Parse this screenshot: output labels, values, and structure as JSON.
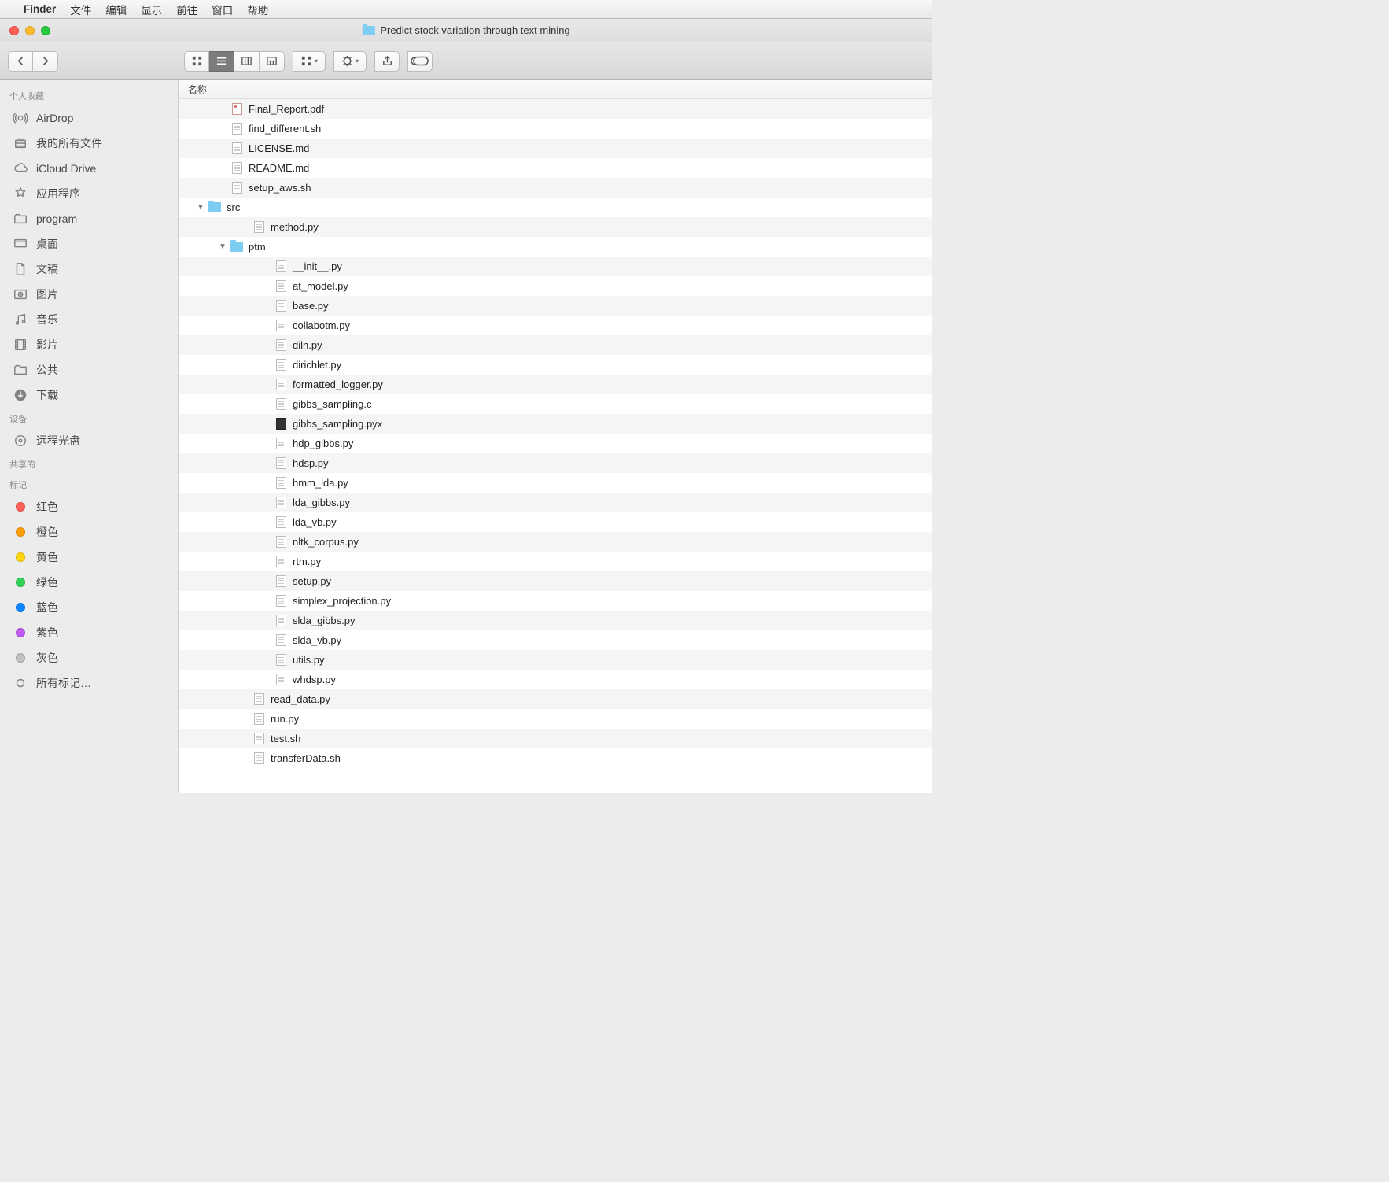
{
  "menubar": {
    "app": "Finder",
    "items": [
      "文件",
      "编辑",
      "显示",
      "前往",
      "窗口",
      "帮助"
    ]
  },
  "window": {
    "title": "Predict stock variation through text mining"
  },
  "list_header": "名称",
  "sidebar": {
    "sections": [
      {
        "label": "个人收藏",
        "items": [
          {
            "icon": "airdrop",
            "label": "AirDrop"
          },
          {
            "icon": "allfiles",
            "label": "我的所有文件"
          },
          {
            "icon": "icloud",
            "label": "iCloud Drive"
          },
          {
            "icon": "apps",
            "label": "应用程序"
          },
          {
            "icon": "folder",
            "label": "program"
          },
          {
            "icon": "desktop",
            "label": "桌面"
          },
          {
            "icon": "docs",
            "label": "文稿"
          },
          {
            "icon": "pictures",
            "label": "图片"
          },
          {
            "icon": "music",
            "label": "音乐"
          },
          {
            "icon": "movies",
            "label": "影片"
          },
          {
            "icon": "folder",
            "label": "公共"
          },
          {
            "icon": "downloads",
            "label": "下载"
          }
        ]
      },
      {
        "label": "设备",
        "items": [
          {
            "icon": "disc",
            "label": "远程光盘"
          }
        ]
      },
      {
        "label": "共享的",
        "items": []
      },
      {
        "label": "标记",
        "items": [
          {
            "icon": "tag",
            "color": "#ff5f56",
            "label": "红色"
          },
          {
            "icon": "tag",
            "color": "#ff9f0a",
            "label": "橙色"
          },
          {
            "icon": "tag",
            "color": "#ffd60a",
            "label": "黄色"
          },
          {
            "icon": "tag",
            "color": "#30d158",
            "label": "绿色"
          },
          {
            "icon": "tag",
            "color": "#0a84ff",
            "label": "蓝色"
          },
          {
            "icon": "tag",
            "color": "#bf5af2",
            "label": "紫色"
          },
          {
            "icon": "tag",
            "color": "#c0c0c0",
            "label": "灰色"
          },
          {
            "icon": "alltags",
            "label": "所有标记…"
          }
        ]
      }
    ]
  },
  "files": [
    {
      "indent": 1,
      "kind": "pdf",
      "name": "Final_Report.pdf"
    },
    {
      "indent": 1,
      "kind": "doc",
      "name": "find_different.sh"
    },
    {
      "indent": 1,
      "kind": "doc",
      "name": "LICENSE.md"
    },
    {
      "indent": 1,
      "kind": "doc",
      "name": "README.md"
    },
    {
      "indent": 1,
      "kind": "doc",
      "name": "setup_aws.sh"
    },
    {
      "indent": 0,
      "kind": "folder",
      "expanded": true,
      "name": "src"
    },
    {
      "indent": 2,
      "kind": "doc",
      "name": "method.py"
    },
    {
      "indent": 1,
      "kind": "folder",
      "expanded": true,
      "name": "ptm"
    },
    {
      "indent": 3,
      "kind": "doc",
      "name": "__init__.py"
    },
    {
      "indent": 3,
      "kind": "doc",
      "name": "at_model.py"
    },
    {
      "indent": 3,
      "kind": "doc",
      "name": "base.py"
    },
    {
      "indent": 3,
      "kind": "doc",
      "name": "collabotm.py"
    },
    {
      "indent": 3,
      "kind": "doc",
      "name": "diln.py"
    },
    {
      "indent": 3,
      "kind": "doc",
      "name": "dirichlet.py"
    },
    {
      "indent": 3,
      "kind": "doc",
      "name": "formatted_logger.py"
    },
    {
      "indent": 3,
      "kind": "doc",
      "name": "gibbs_sampling.c"
    },
    {
      "indent": 3,
      "kind": "dark",
      "name": "gibbs_sampling.pyx"
    },
    {
      "indent": 3,
      "kind": "doc",
      "name": "hdp_gibbs.py"
    },
    {
      "indent": 3,
      "kind": "doc",
      "name": "hdsp.py"
    },
    {
      "indent": 3,
      "kind": "doc",
      "name": "hmm_lda.py"
    },
    {
      "indent": 3,
      "kind": "doc",
      "name": "lda_gibbs.py"
    },
    {
      "indent": 3,
      "kind": "doc",
      "name": "lda_vb.py"
    },
    {
      "indent": 3,
      "kind": "doc",
      "name": "nltk_corpus.py"
    },
    {
      "indent": 3,
      "kind": "doc",
      "name": "rtm.py"
    },
    {
      "indent": 3,
      "kind": "doc",
      "name": "setup.py"
    },
    {
      "indent": 3,
      "kind": "doc",
      "name": "simplex_projection.py"
    },
    {
      "indent": 3,
      "kind": "doc",
      "name": "slda_gibbs.py"
    },
    {
      "indent": 3,
      "kind": "doc",
      "name": "slda_vb.py"
    },
    {
      "indent": 3,
      "kind": "doc",
      "name": "utils.py"
    },
    {
      "indent": 3,
      "kind": "doc",
      "name": "whdsp.py"
    },
    {
      "indent": 2,
      "kind": "doc",
      "name": "read_data.py"
    },
    {
      "indent": 2,
      "kind": "doc",
      "name": "run.py"
    },
    {
      "indent": 2,
      "kind": "doc",
      "name": "test.sh"
    },
    {
      "indent": 2,
      "kind": "doc",
      "name": "transferData.sh"
    }
  ]
}
